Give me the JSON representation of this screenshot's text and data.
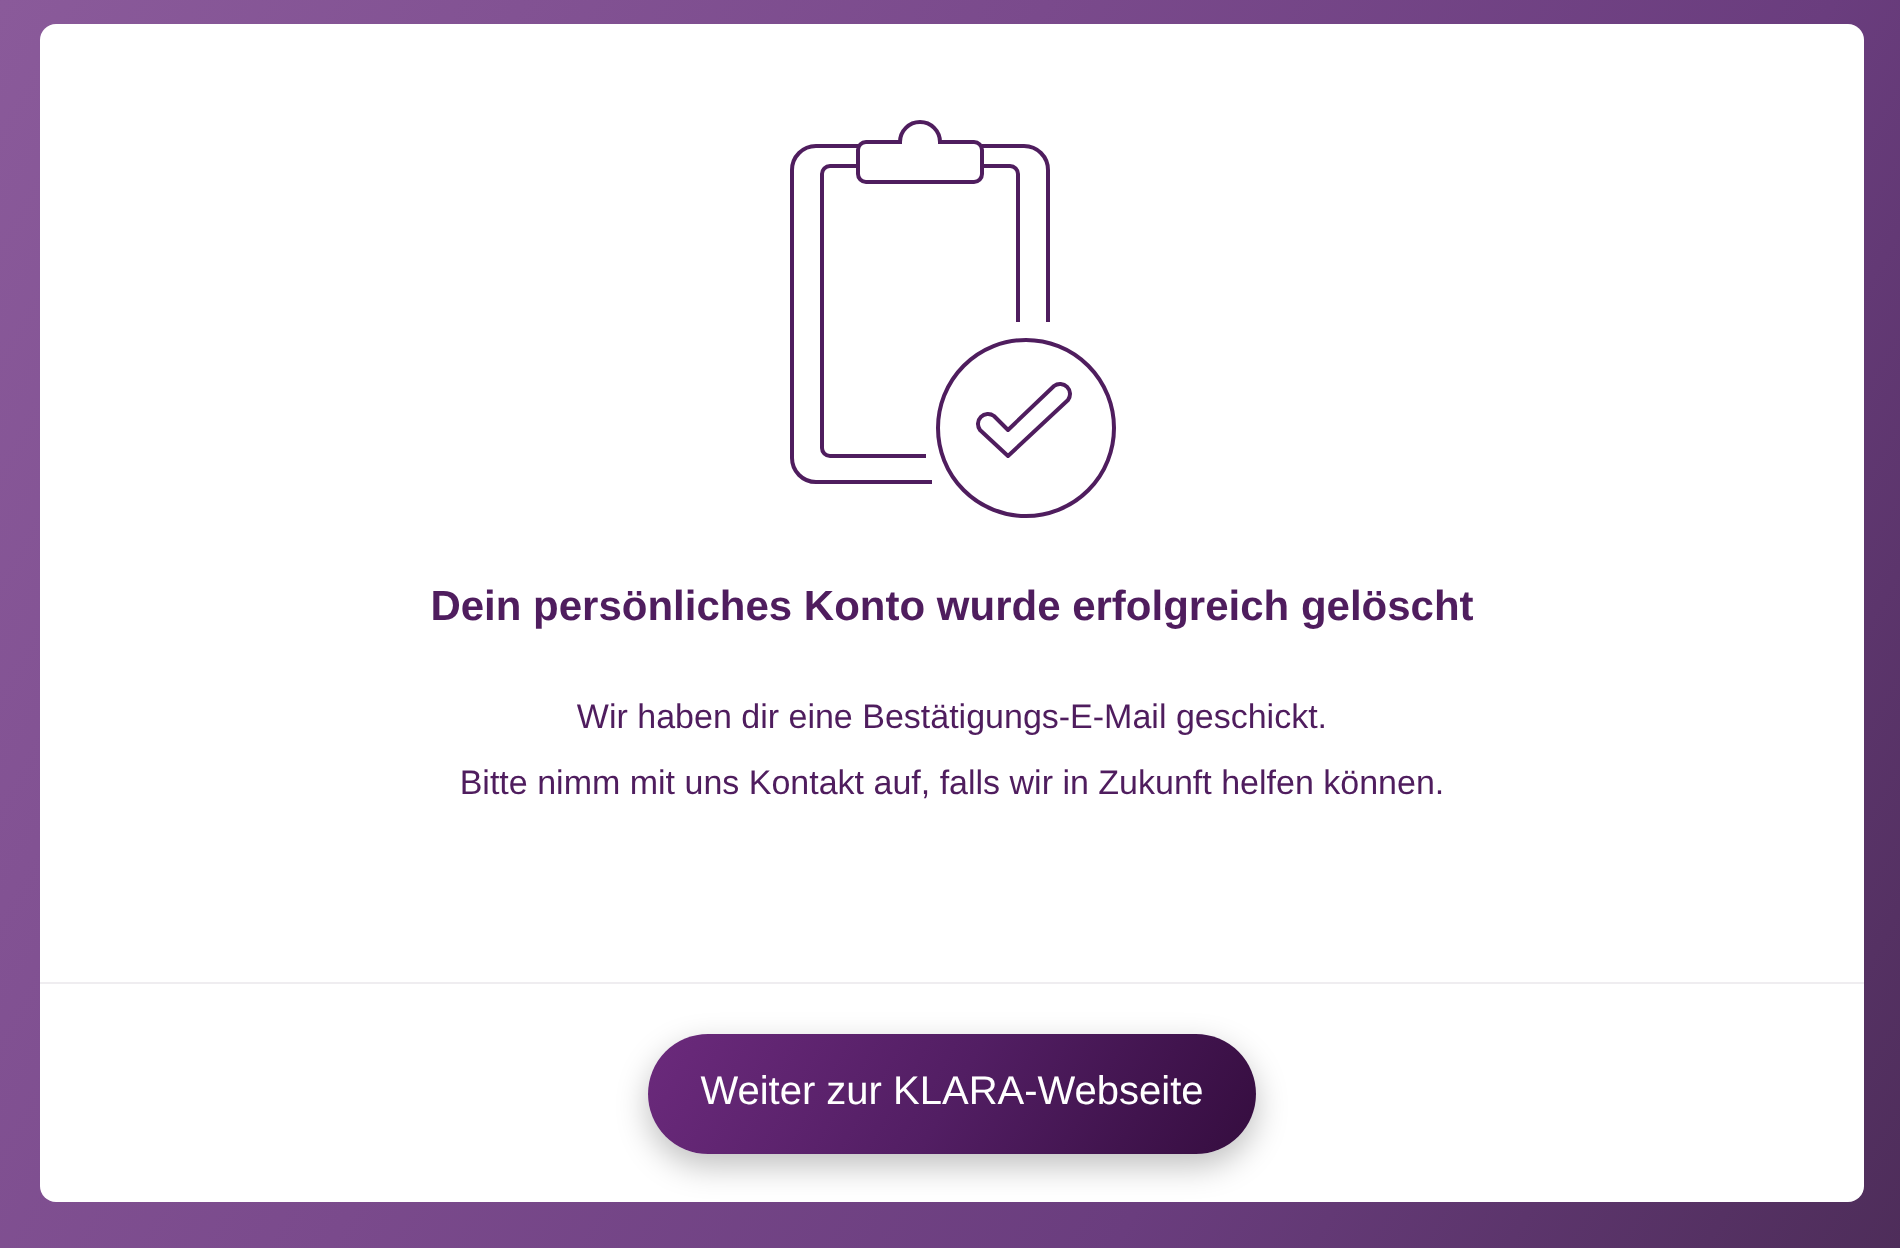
{
  "dialog": {
    "title": "Dein persönliches Konto wurde erfolgreich gelöscht",
    "message_lines": [
      "Wir haben dir eine Bestätigungs-E-Mail geschickt.",
      "Bitte nimm mit uns Kontakt auf, falls wir in Zukunft helfen können."
    ],
    "button": "Weiter zur KLARA-Webseite"
  }
}
